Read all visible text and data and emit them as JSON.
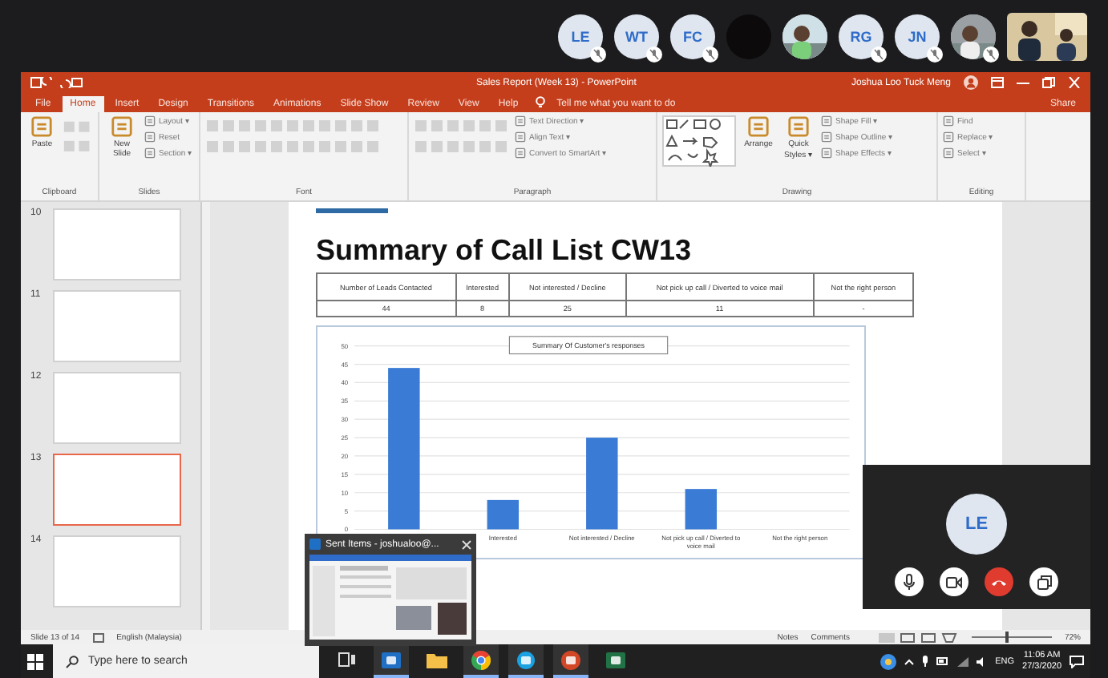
{
  "call": {
    "participants": [
      {
        "kind": "initials",
        "label": "LE",
        "muted": true
      },
      {
        "kind": "initials",
        "label": "WT",
        "muted": true
      },
      {
        "kind": "initials",
        "label": "FC",
        "muted": true
      },
      {
        "kind": "dark",
        "muted": false
      },
      {
        "kind": "video",
        "muted": false
      },
      {
        "kind": "initials",
        "label": "RG",
        "muted": true
      },
      {
        "kind": "initials",
        "label": "JN",
        "muted": true
      },
      {
        "kind": "video",
        "muted": true
      },
      {
        "kind": "wide_video",
        "muted": false
      }
    ]
  },
  "window": {
    "title": "Sales Report (Week 13)  -  PowerPoint",
    "user": "Joshua Loo Tuck Meng"
  },
  "tabs": [
    {
      "label": "File",
      "selected": false
    },
    {
      "label": "Home",
      "selected": true
    },
    {
      "label": "Insert",
      "selected": false
    },
    {
      "label": "Design",
      "selected": false
    },
    {
      "label": "Transitions",
      "selected": false
    },
    {
      "label": "Animations",
      "selected": false
    },
    {
      "label": "Slide Show",
      "selected": false
    },
    {
      "label": "Review",
      "selected": false
    },
    {
      "label": "View",
      "selected": false
    },
    {
      "label": "Help",
      "selected": false
    }
  ],
  "tell_me": "Tell me what you want to do",
  "share": "Share",
  "ribbon": [
    {
      "label": "Clipboard",
      "items": [
        {
          "kind": "large",
          "label": "Paste"
        },
        {
          "kind": "tools"
        }
      ]
    },
    {
      "label": "Slides",
      "items": [
        {
          "kind": "large",
          "label": "New Slide"
        },
        {
          "kind": "small",
          "label": "Layout ▾"
        },
        {
          "kind": "small",
          "label": "Reset"
        },
        {
          "kind": "small",
          "label": "Section ▾"
        }
      ]
    },
    {
      "label": "Font",
      "items": [
        {
          "kind": "tools"
        }
      ]
    },
    {
      "label": "Paragraph",
      "items": [
        {
          "kind": "tools"
        },
        {
          "kind": "small",
          "label": "Text Direction ▾"
        },
        {
          "kind": "small",
          "label": "Align Text ▾"
        },
        {
          "kind": "small",
          "label": "Convert to SmartArt ▾"
        }
      ]
    },
    {
      "label": "Drawing",
      "items": [
        {
          "kind": "gallery"
        },
        {
          "kind": "large",
          "label": "Arrange"
        },
        {
          "kind": "large",
          "label": "Quick Styles ▾"
        },
        {
          "kind": "small",
          "label": "Shape Fill ▾"
        },
        {
          "kind": "small",
          "label": "Shape Outline ▾"
        },
        {
          "kind": "small",
          "label": "Shape Effects ▾"
        }
      ]
    },
    {
      "label": "Editing",
      "items": [
        {
          "kind": "small",
          "label": "Find"
        },
        {
          "kind": "small",
          "label": "Replace ▾"
        },
        {
          "kind": "small",
          "label": "Select ▾"
        }
      ]
    }
  ],
  "thumbnails": [
    {
      "number": "10",
      "selected": false
    },
    {
      "number": "11",
      "selected": false
    },
    {
      "number": "12",
      "selected": false
    },
    {
      "number": "13",
      "selected": true
    },
    {
      "number": "14",
      "selected": false
    }
  ],
  "slide": {
    "title": "Summary of Call List CW13",
    "table": {
      "columns": [
        "Number of Leads Contacted",
        "Interested",
        "Not interested / Decline",
        "Not pick up call / Diverted to voice mail",
        "Not the right person"
      ],
      "rows": [
        [
          "44",
          "8",
          "25",
          "11",
          "-"
        ]
      ]
    },
    "chart_data": {
      "type": "bar",
      "title": "Summary Of Customer's responses",
      "categories": [
        null,
        "Interested",
        "Not interested / Decline",
        "Not pick up call / Diverted to voice mail",
        "Not the right person"
      ],
      "values": [
        44,
        8,
        25,
        11,
        0
      ],
      "ylim": [
        0,
        50
      ],
      "grid": true,
      "yticks": [
        0,
        5,
        10,
        15,
        20,
        25,
        30,
        35,
        40,
        45,
        50
      ]
    }
  },
  "popup": {
    "title": "Sent Items - joshualoo@..."
  },
  "video_tile": {
    "initials": "LE"
  },
  "status": {
    "slide_info": "Slide 13 of 14",
    "language": "English (Malaysia)",
    "notes": "Notes",
    "comments": "Comments",
    "zoom": "72%",
    "zoom_slider": {
      "level": 0.45
    }
  },
  "taskbar": {
    "search_placeholder": "Type here to search",
    "apps": [
      {
        "kind": "taskview",
        "active": false
      },
      {
        "kind": "outlook",
        "active": true
      },
      {
        "kind": "explorer",
        "active": false
      },
      {
        "kind": "chrome",
        "active": true
      },
      {
        "kind": "skype",
        "active": true
      },
      {
        "kind": "powerpoint",
        "active": true
      },
      {
        "kind": "excel",
        "active": false
      }
    ],
    "lang": "ENG",
    "time": "11:06 AM",
    "date": "27/3/2020"
  }
}
